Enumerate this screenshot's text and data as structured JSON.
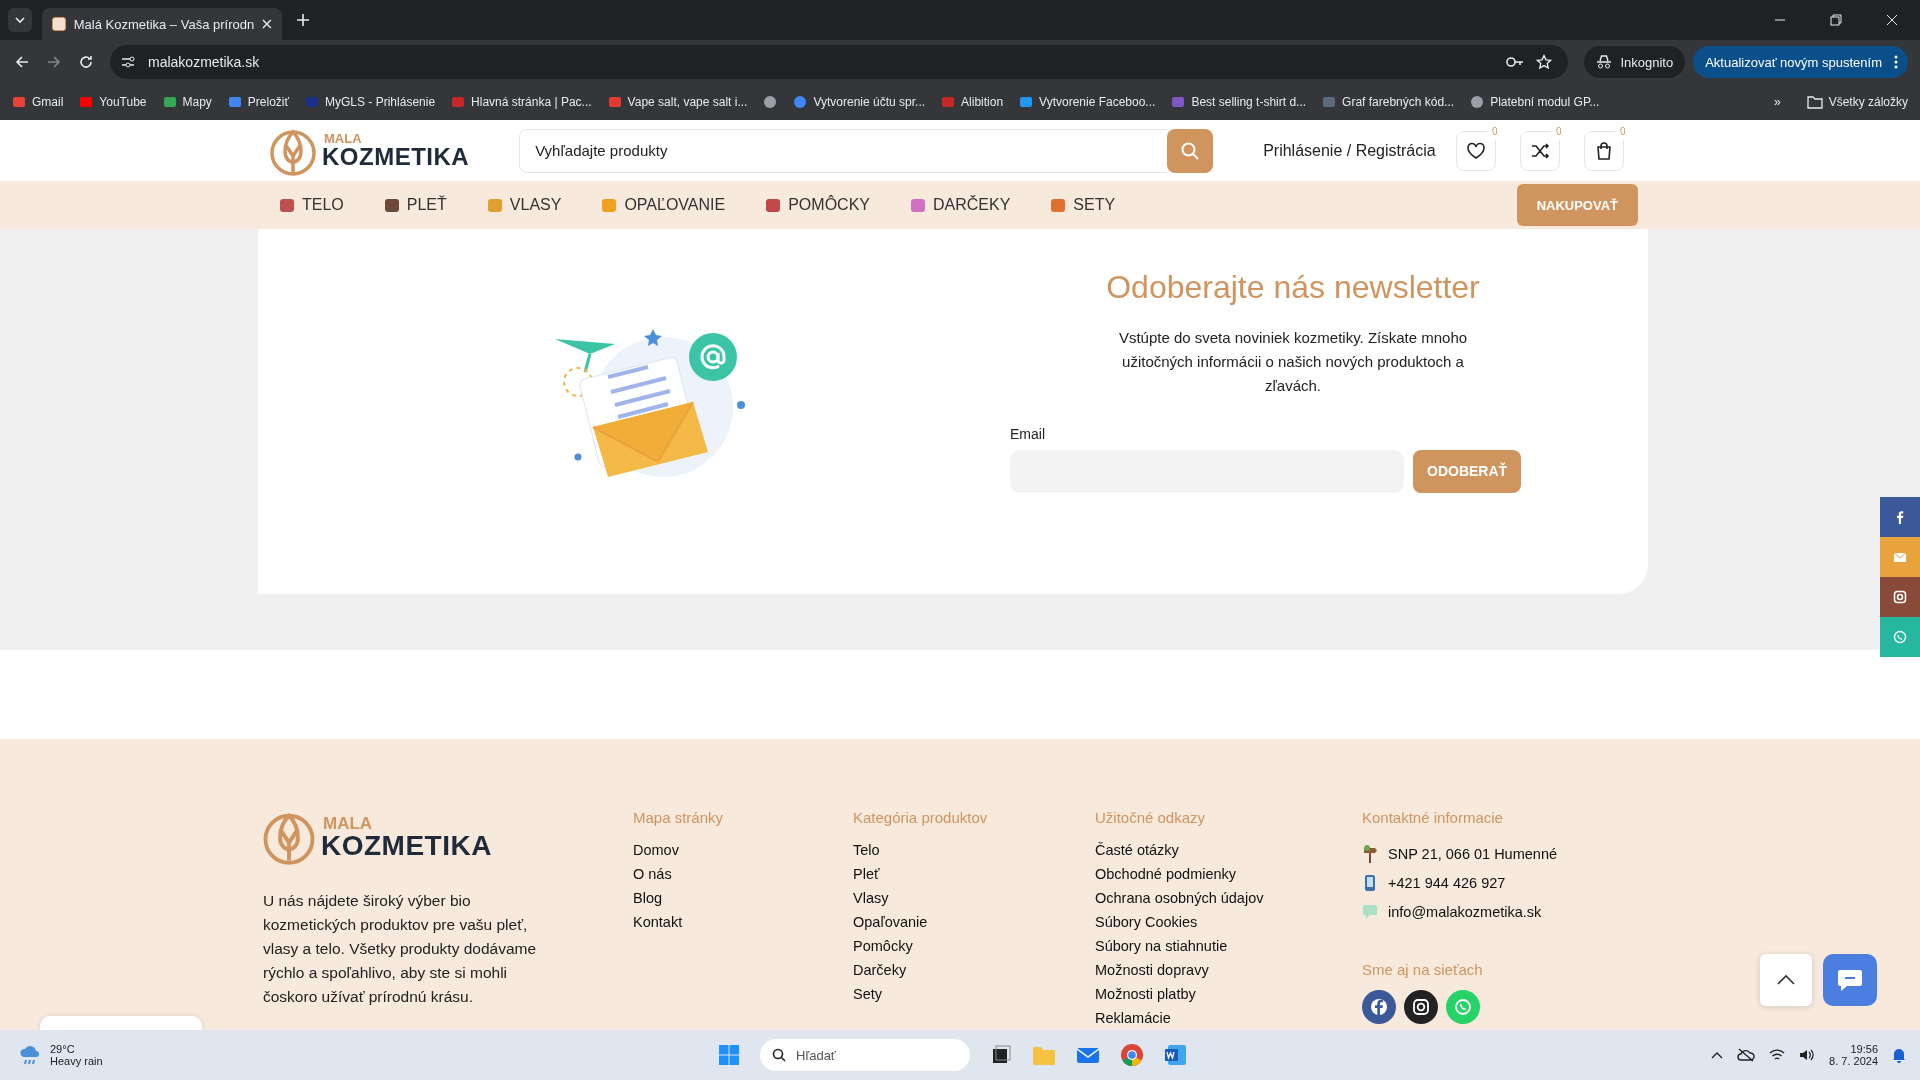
{
  "browser": {
    "tabs": [
      {
        "title": "Malá Kozmetika – Vaša prírodn",
        "selected": true
      }
    ],
    "url": "malakozmetika.sk",
    "incognito": "Inkognito",
    "update_button": "Aktualizovať novým spustením",
    "bookmarks": [
      {
        "kind": "gmail",
        "label": "Gmail"
      },
      {
        "kind": "youtube",
        "label": "YouTube"
      },
      {
        "kind": "maps",
        "label": "Mapy"
      },
      {
        "kind": "translate",
        "label": "Preložiť"
      },
      {
        "kind": "gls",
        "label": "MyGLS - Prihlásenie"
      },
      {
        "kind": "shield",
        "label": "Hlavná stránka | Pac..."
      },
      {
        "kind": "vape",
        "label": "Vape salt, vape salt i..."
      },
      {
        "kind": "globe"
      },
      {
        "kind": "google",
        "label": "Vytvorenie účtu spr..."
      },
      {
        "kind": "shield",
        "label": "Alibition"
      },
      {
        "kind": "diamond",
        "label": "Vytvorenie Faceboo..."
      },
      {
        "kind": "star",
        "label": "Best selling t-shirt d..."
      },
      {
        "kind": "rt",
        "label": "Graf farebných kód..."
      },
      {
        "kind": "globe",
        "label": "Platební modul GP..."
      }
    ],
    "more": "»",
    "all_bookmarks": "Všetky záložky"
  },
  "header": {
    "logo_top": "MALA",
    "logo_bottom": "KOZMETIKA",
    "search": {
      "placeholder": "Vyhľadajte produkty"
    },
    "login": "Prihlásenie / Registrácia",
    "icons": [
      {
        "kind": "heart",
        "count": "0"
      },
      {
        "kind": "shuffle",
        "count": "0"
      },
      {
        "kind": "bag",
        "count": "0"
      }
    ]
  },
  "nav": {
    "items": [
      {
        "label": "TELO",
        "color": "#c0504d"
      },
      {
        "label": "PLEŤ",
        "color": "#6b4a3a"
      },
      {
        "label": "VLASY",
        "color": "#e0a030"
      },
      {
        "label": "OPAĽOVANIE",
        "color": "#f0a020"
      },
      {
        "label": "POMÔCKY",
        "color": "#c04848"
      },
      {
        "label": "DARČEKY",
        "color": "#d070c0"
      },
      {
        "label": "SETY",
        "color": "#e07030"
      }
    ],
    "cta": "NAKUPOVAŤ"
  },
  "newsletter": {
    "title": "Odoberajte nás newsletter",
    "text": "Vstúpte do sveta noviniek kozmetiky. Získate mnoho užitočných informácii o našich nových produktoch a zľavách.",
    "email_label": "Email",
    "button": "ODOBERAŤ"
  },
  "social_bar": [
    {
      "kind": "facebook",
      "color": "#3b5998"
    },
    {
      "kind": "mail",
      "color": "#e8a33d"
    },
    {
      "kind": "instagram",
      "color": "#8a4a3a"
    },
    {
      "kind": "whatsapp",
      "color": "#26b7a0"
    }
  ],
  "footer": {
    "logo_top": "MALA",
    "logo_bottom": "KOZMETIKA",
    "about": "U nás nájdete široký výber bio kozmetických produktov pre vašu pleť, vlasy a telo. Všetky produkty dodávame rýchlo a spoľahlivo, aby ste si mohli čoskoro užívať prírodnú krásu.",
    "columns": [
      {
        "title": "Mapa stránky",
        "links": [
          "Domov",
          "O nás",
          "Blog",
          "Kontakt"
        ]
      },
      {
        "title": "Kategória produktov",
        "links": [
          "Telo",
          "Pleť",
          "Vlasy",
          "Opaľovanie",
          "Pomôcky",
          "Darčeky",
          "Sety"
        ]
      },
      {
        "title": "Užitočné odkazy",
        "links": [
          "Časté otázky",
          "Obchodné podmienky",
          "Ochrana osobných údajov",
          "Súbory Cookies",
          "Súbory na stiahnutie",
          "Možnosti dopravy",
          "Možnosti platby",
          "Reklamácie"
        ]
      }
    ],
    "contact": {
      "title": "Kontaktné informacie",
      "items": [
        {
          "kind": "address",
          "text": "SNP 21, 066 01 Humenné"
        },
        {
          "kind": "phone",
          "text": "+421 944 426 927"
        },
        {
          "kind": "email",
          "text": "info@malakozmetika.sk"
        }
      ]
    },
    "social": {
      "title": "Sme aj na sieťach",
      "items": [
        {
          "kind": "facebook",
          "color": "#3b5998"
        },
        {
          "kind": "instagram",
          "color": "#222222"
        },
        {
          "kind": "whatsapp",
          "color": "#25d366"
        }
      ]
    }
  },
  "taskbar": {
    "temperature": "29°C",
    "weather": "Heavy rain",
    "search": {
      "placeholder": "Hľadať"
    },
    "time": "19:56",
    "date": "8. 7. 2024"
  }
}
